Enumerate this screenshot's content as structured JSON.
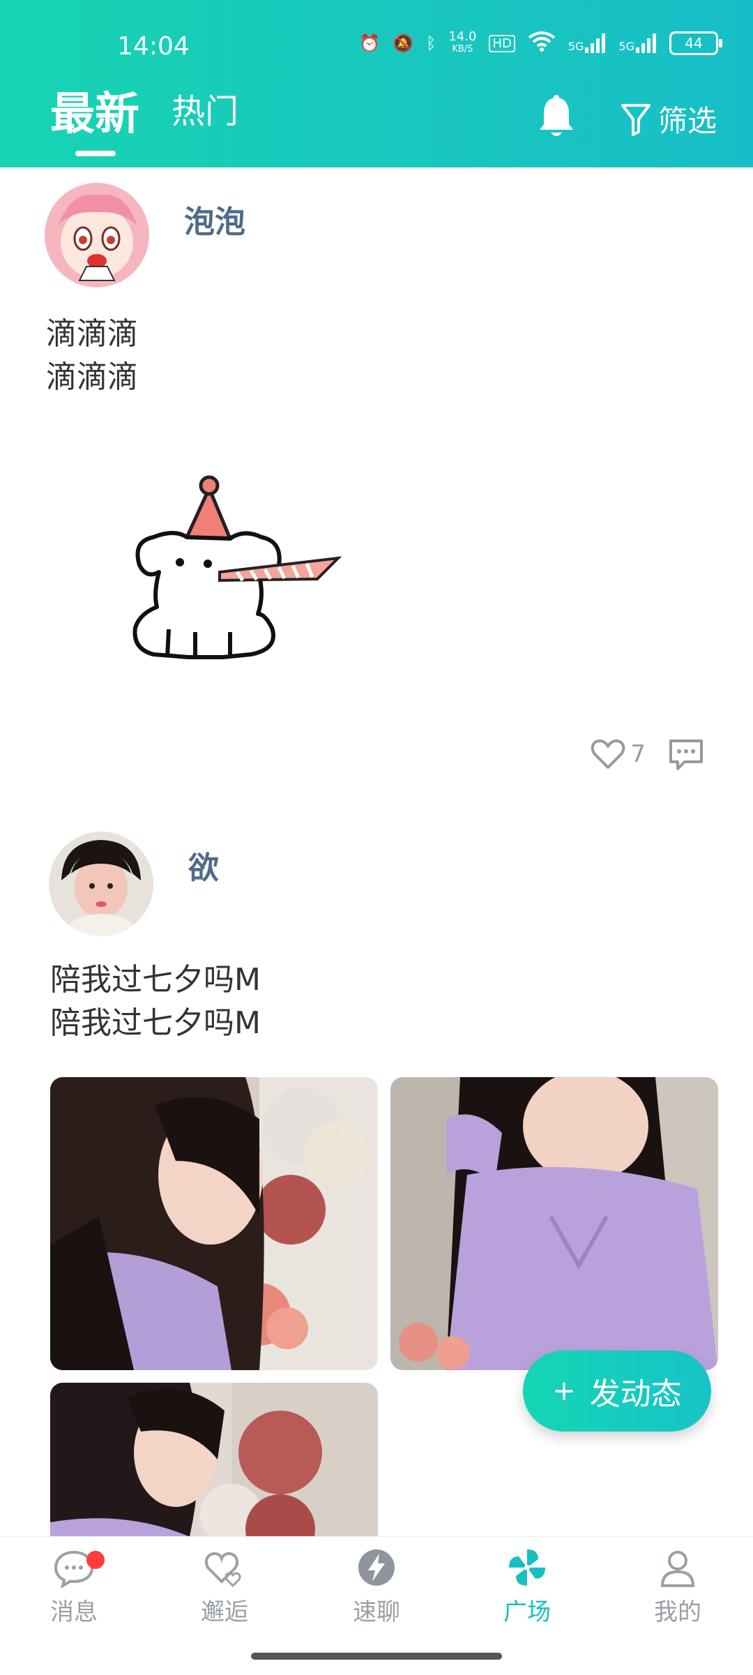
{
  "status_bar": {
    "time": "14:04",
    "net_speed": "14.0",
    "net_unit": "KB/S",
    "hd_label": "HD",
    "signal_1": "5G",
    "signal_2": "5G",
    "battery": "44"
  },
  "header": {
    "tabs": [
      {
        "label": "最新",
        "active": true
      },
      {
        "label": "热门",
        "active": false
      }
    ],
    "bell_icon": "bell-icon",
    "filter_label": "筛选"
  },
  "posts": [
    {
      "username": "泡泡",
      "text_lines": [
        "滴滴滴",
        "滴滴滴"
      ],
      "likes": "7"
    },
    {
      "username": "欲",
      "text_lines": [
        "陪我过七夕吗M",
        "陪我过七夕吗M"
      ]
    }
  ],
  "fab": {
    "label": "发动态",
    "icon": "plus-icon"
  },
  "bottom_nav": [
    {
      "label": "消息",
      "icon": "chat-bubble-icon",
      "badge": true
    },
    {
      "label": "邂逅",
      "icon": "hearts-icon"
    },
    {
      "label": "速聊",
      "icon": "lightning-icon"
    },
    {
      "label": "广场",
      "icon": "pinwheel-icon",
      "active": true
    },
    {
      "label": "我的",
      "icon": "person-icon"
    }
  ],
  "colors": {
    "accent": "#17c0c0",
    "header_gradient_start": "#18d4b2",
    "username": "#4f6b8c",
    "badge": "#ff3b3b"
  }
}
